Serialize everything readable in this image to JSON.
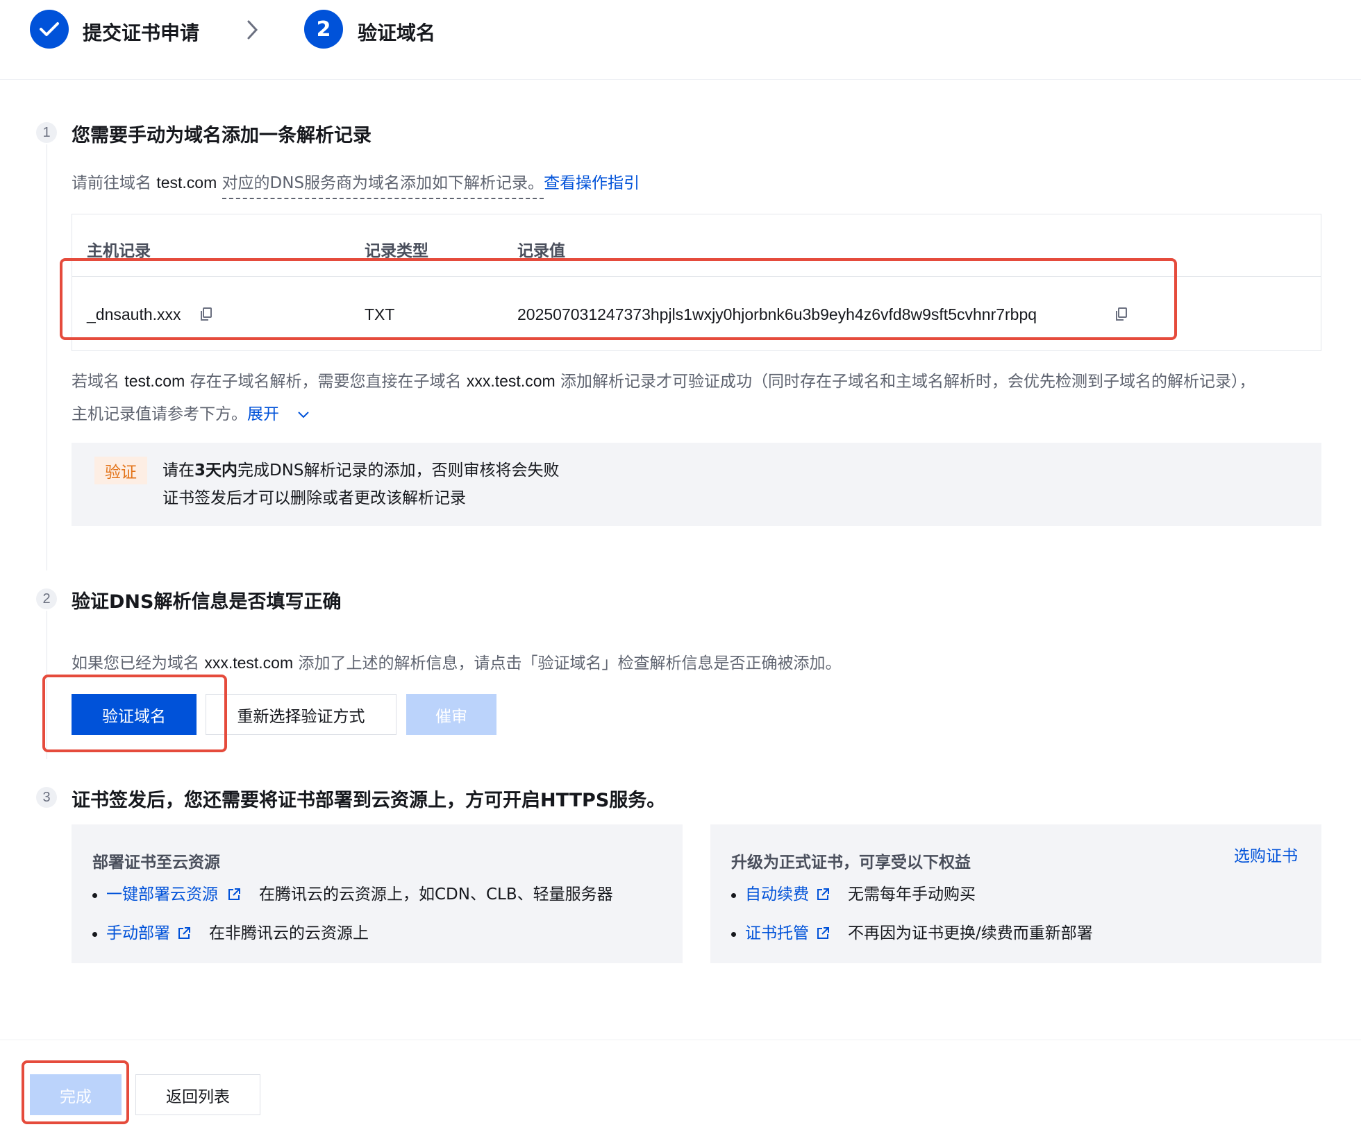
{
  "steps": {
    "step1_label": "提交证书申请",
    "step2_number": "2",
    "step2_label": "验证域名"
  },
  "section1": {
    "number": "1",
    "title": "您需要手动为域名添加一条解析记录",
    "intro_prefix": "请前往域名",
    "intro_domain": "test.com",
    "intro_suffix": "对应的DNS服务商为域名添加如下解析记录。",
    "guide_link": "查看操作指引",
    "table": {
      "headers": [
        "主机记录",
        "记录类型",
        "记录值"
      ],
      "row": {
        "host": "_dnsauth.xxx",
        "type": "TXT",
        "value": "202507031247373hpjls1wxjy0hjorbnk6u3b9eyh4z6vfd8w9sft5cvhnr7rbpq"
      }
    },
    "subdomain_note": {
      "p1": "若域名",
      "domain": "test.com",
      "p2": "存在子域名解析，需要您直接在子域名",
      "subdomain": "xxx.test.com",
      "p3": "添加解析记录才可验证成功（同时存在子域名和主域名解析时，会优先检测到子域名的解析记录），",
      "line2": "主机记录值请参考下方。",
      "expand_link": "展开"
    },
    "notice": {
      "tag": "验证",
      "line1_a": "请在",
      "line1_bold": "3天内",
      "line1_b": "完成DNS解析记录的添加，否则审核将会失败",
      "line2": "证书签发后才可以删除或者更改该解析记录"
    }
  },
  "section2": {
    "number": "2",
    "title": "验证DNS解析信息是否填写正确",
    "desc_a": "如果您已经为域名",
    "desc_domain": "xxx.test.com",
    "desc_b": "添加了上述的解析信息，请点击「验证域名」检查解析信息是否正确被添加。",
    "verify_button": "验证域名",
    "reselect_button": "重新选择验证方式",
    "urge_button": "催审"
  },
  "section3": {
    "number": "3",
    "title": "证书签发后，您还需要将证书部署到云资源上，方可开启HTTPS服务。",
    "deploy_card": {
      "title": "部署证书至云资源",
      "items": [
        {
          "link": "一键部署云资源",
          "text": "在腾讯云的云资源上，如CDN、CLB、轻量服务器"
        },
        {
          "link": "手动部署",
          "text": "在非腾讯云的云资源上"
        }
      ]
    },
    "upgrade_card": {
      "title": "升级为正式证书，可享受以下权益",
      "buy_link": "选购证书",
      "items": [
        {
          "link": "自动续费",
          "text": "无需每年手动购买"
        },
        {
          "link": "证书托管",
          "text": "不再因为证书更换/续费而重新部署"
        }
      ]
    }
  },
  "footer": {
    "done_button": "完成",
    "back_button": "返回列表"
  },
  "colors": {
    "primary": "#0052d9",
    "highlight_border": "#e54b3c",
    "disabled": "#bbd3fb",
    "tag_bg": "#fdeee4",
    "tag_text": "#e37318"
  }
}
